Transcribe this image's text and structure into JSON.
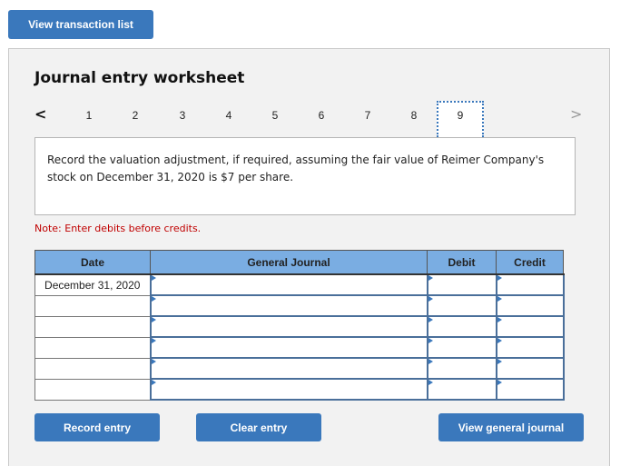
{
  "top_button": "View transaction list",
  "worksheet": {
    "title": "Journal entry worksheet",
    "pages": [
      "1",
      "2",
      "3",
      "4",
      "5",
      "6",
      "7",
      "8",
      "9"
    ],
    "active_page": "9",
    "prev_icon": "<",
    "next_icon": ">",
    "prompt": "Record the valuation adjustment, if required, assuming the fair value of Reimer Company's stock on December 31, 2020 is $7 per share.",
    "note": "Note: Enter debits before credits."
  },
  "table": {
    "headers": [
      "Date",
      "General Journal",
      "Debit",
      "Credit"
    ],
    "rows": [
      {
        "date": "December 31, 2020",
        "account": "",
        "debit": "",
        "credit": ""
      },
      {
        "date": "",
        "account": "",
        "debit": "",
        "credit": ""
      },
      {
        "date": "",
        "account": "",
        "debit": "",
        "credit": ""
      },
      {
        "date": "",
        "account": "",
        "debit": "",
        "credit": ""
      },
      {
        "date": "",
        "account": "",
        "debit": "",
        "credit": ""
      },
      {
        "date": "",
        "account": "",
        "debit": "",
        "credit": ""
      }
    ]
  },
  "buttons": {
    "record": "Record entry",
    "clear": "Clear entry",
    "view_journal": "View general journal"
  }
}
